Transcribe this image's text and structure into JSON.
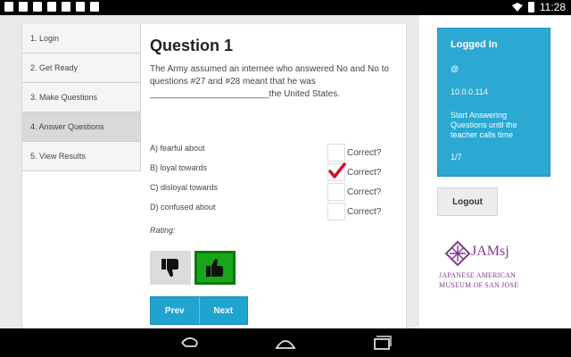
{
  "status_bar": {
    "time": "11:28"
  },
  "steps": [
    {
      "label": "1. Login"
    },
    {
      "label": "2. Get Ready"
    },
    {
      "label": "3. Make Questions"
    },
    {
      "label": "4. Answer Questions"
    },
    {
      "label": "5. View Results"
    }
  ],
  "question": {
    "title": "Question 1",
    "text": "The Army assumed an internee who answered No and No to questions #27 and #28 meant that he was ________________________the United States.",
    "answers": [
      {
        "label": "A) fearful about",
        "correct_label": "Correct?",
        "checked": false
      },
      {
        "label": "B) loyal towards",
        "correct_label": "Correct?",
        "checked": true
      },
      {
        "label": "C) disloyal towards",
        "correct_label": "Correct?",
        "checked": false
      },
      {
        "label": "D) confused about",
        "correct_label": "Correct?",
        "checked": false
      }
    ],
    "rating_label": "Rating:",
    "selected_rating": "thumbs-up"
  },
  "nav_buttons": {
    "prev": "Prev",
    "next": "Next"
  },
  "login_box": {
    "title": "Logged In",
    "at": "@",
    "ip": "10.0.0.114",
    "message": "Start Answering Questions until the teacher calls time",
    "progress": "1/7"
  },
  "logout_label": "Logout",
  "logo": {
    "mark": "JAMsj",
    "line1": "JAPANESE AMERICAN",
    "line2": "MUSEUM OF SAN JOSE"
  },
  "colors": {
    "accent": "#2ba9d3",
    "check": "#d0102a",
    "thumb_up": "#19a519"
  }
}
